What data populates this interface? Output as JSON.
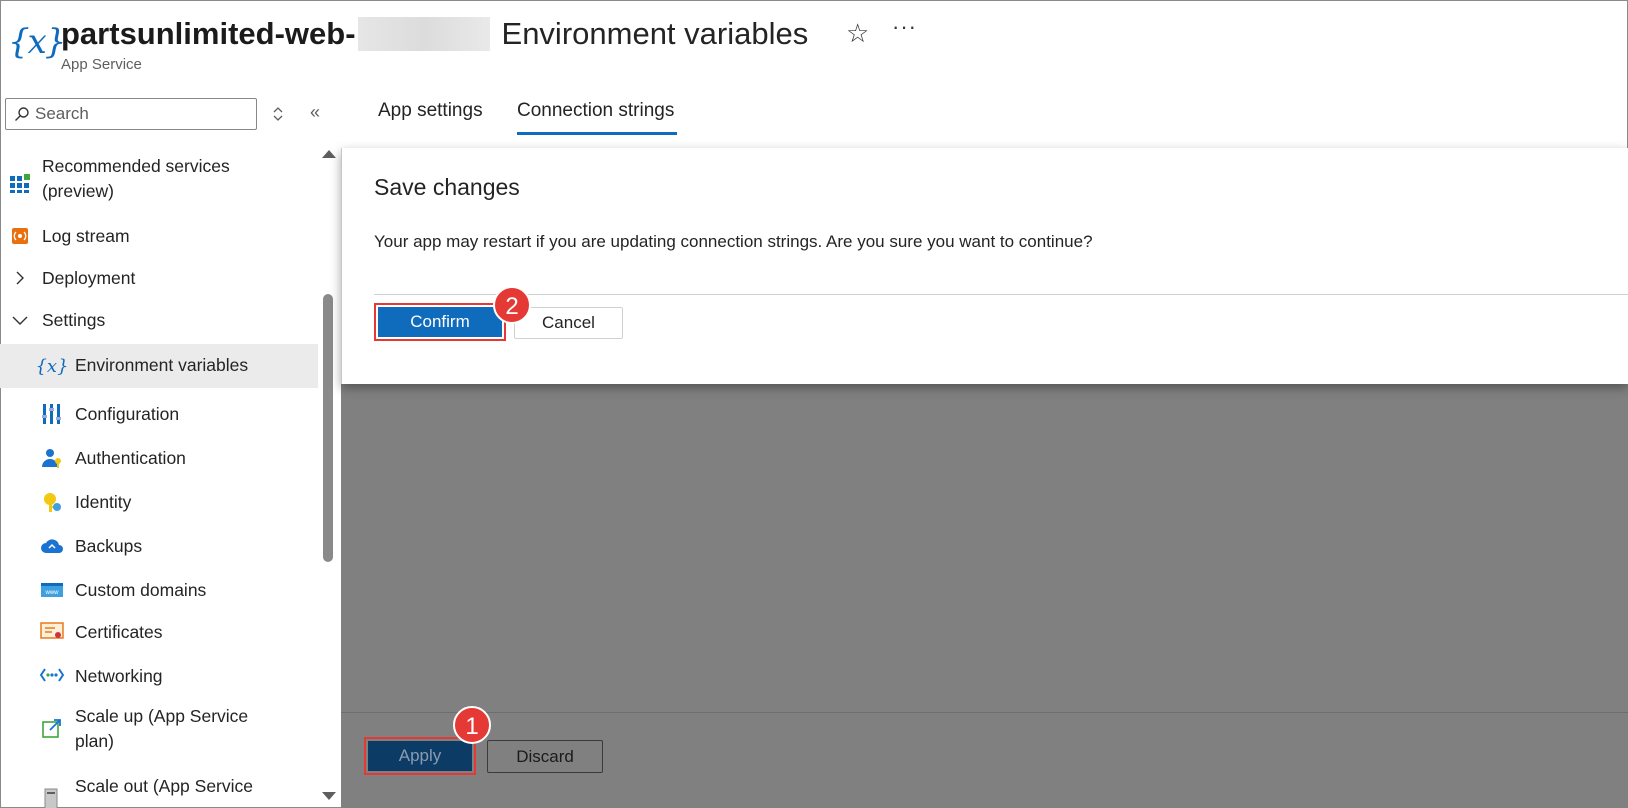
{
  "header": {
    "icon": "environment-variables-icon",
    "resource_name": "partsunlimited-web-",
    "page_title": "Environment variables",
    "subtitle": "App Service",
    "favorite_icon": "star-icon",
    "more_label": "···"
  },
  "search": {
    "placeholder": "Search",
    "value": ""
  },
  "sidebar": {
    "collapse_label": "«",
    "items": [
      {
        "label": "Recommended services",
        "label2": "(preview)",
        "icon": "grid-icon"
      },
      {
        "label": "Log stream",
        "icon": "log-stream-icon"
      },
      {
        "label": "Deployment",
        "icon": "chevron-right-icon"
      },
      {
        "label": "Settings",
        "icon": "chevron-down-icon"
      },
      {
        "label": "Environment variables",
        "icon": "environment-variables-icon",
        "selected": true
      },
      {
        "label": "Configuration",
        "icon": "configuration-icon"
      },
      {
        "label": "Authentication",
        "icon": "authentication-icon"
      },
      {
        "label": "Identity",
        "icon": "identity-icon"
      },
      {
        "label": "Backups",
        "icon": "backups-icon"
      },
      {
        "label": "Custom domains",
        "icon": "custom-domains-icon"
      },
      {
        "label": "Certificates",
        "icon": "certificates-icon"
      },
      {
        "label": "Networking",
        "icon": "networking-icon"
      },
      {
        "label": "Scale up (App Service",
        "label2": "plan)",
        "icon": "scale-up-icon"
      },
      {
        "label": "Scale out (App Service",
        "icon": "scale-out-icon"
      }
    ]
  },
  "tabs": [
    {
      "label": "App settings"
    },
    {
      "label": "Connection strings",
      "active": true
    }
  ],
  "dialog": {
    "title": "Save changes",
    "message": "Your app may restart if you are updating connection strings. Are you sure you want to continue?",
    "confirm_label": "Confirm",
    "cancel_label": "Cancel"
  },
  "footer": {
    "apply_label": "Apply",
    "discard_label": "Discard"
  },
  "steps": {
    "one": "1",
    "two": "2"
  },
  "colors": {
    "accent": "#0f6cbd",
    "overlay": "#808080",
    "step_badge": "#e53935"
  }
}
